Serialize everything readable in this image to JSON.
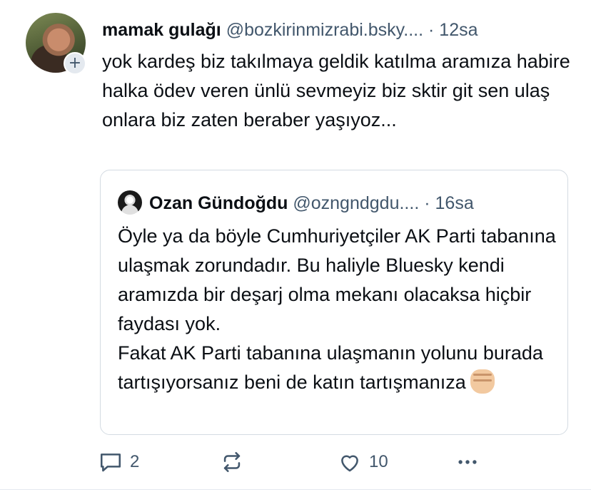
{
  "post": {
    "author_name": "mamak gulağı",
    "author_handle": "@bozkirinmizrabi.bsky....",
    "separator": "·",
    "time": "12sa",
    "text": "yok kardeş biz takılmaya geldik katılma aramıza habire halka ödev veren ünlü sevmeyiz biz sktir git sen ulaş onlara biz zaten beraber yaşıyoz...",
    "follow_symbol": "+"
  },
  "quote": {
    "author_name": "Ozan Gündoğdu",
    "author_handle": "@ozngndgdu....",
    "separator": "·",
    "time": "16sa",
    "text_line1": "Öyle ya da böyle Cumhuriyetçiler AK Parti tabanına ulaşmak zorundadır. Bu haliyle Bluesky kendi aramızda bir deşarj olma mekanı olacaksa hiçbir faydası yok.",
    "text_line2": "Fakat AK Parti tabanına ulaşmanın yolunu burada tartışıyorsanız beni de katın tartışmanıza",
    "emoji": "raised-fist-emoji"
  },
  "actions": {
    "reply_count": "2",
    "repost_count": "",
    "like_count": "10",
    "icons": [
      "reply-icon",
      "repost-icon",
      "like-icon",
      "more-icon"
    ]
  },
  "colors": {
    "text": "#0b0f14",
    "secondary": "#42576c",
    "border": "#d4dbe2"
  }
}
